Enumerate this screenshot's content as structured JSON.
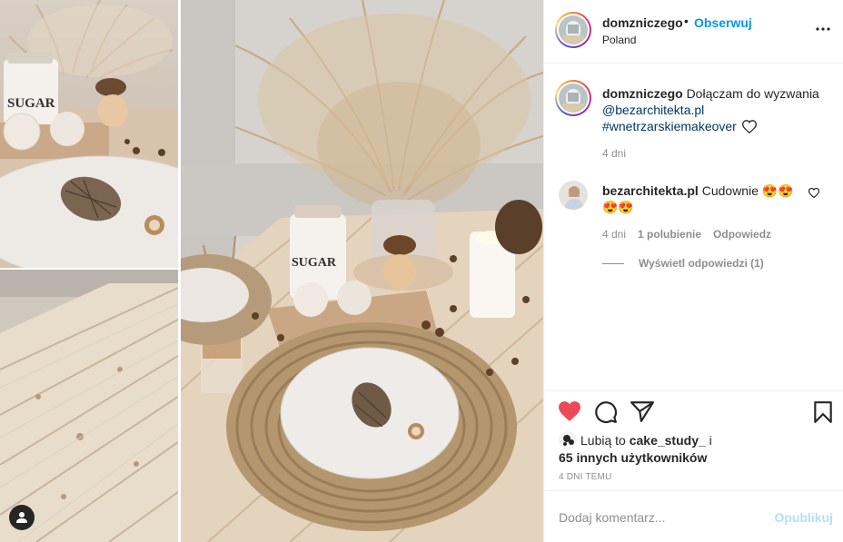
{
  "post": {
    "username": "domzniczego",
    "follow_label": "Obserwuj",
    "separator": "•",
    "location": "Poland",
    "more_icon": "more-horizontal-icon"
  },
  "caption": {
    "username": "domzniczego",
    "text": "Dołączam do wyzwania",
    "mention": "@bezarchitekta.pl",
    "hashtag": "#wnetrzarskiemakeover",
    "time": "4 dni"
  },
  "comment": {
    "username": "bezarchitekta.pl",
    "text": "Cudownie 😍😍😍😍",
    "time": "4 dni",
    "likes": "1 polubienie",
    "reply_label": "Odpowiedz",
    "view_replies": "Wyświetl odpowiedzi (1)"
  },
  "likes": {
    "prefix": "Lubią to",
    "user": "cake_study_",
    "conjunction": "i",
    "others": "65 innych użytkowników"
  },
  "date_label": "4 DNI TEMU",
  "add_comment": {
    "placeholder": "Dodaj komentarz...",
    "publish_label": "Opublikuj"
  },
  "media": {
    "jar_label": "SUGAR",
    "jar_label_small": "SUGAR"
  },
  "colors": {
    "like_red": "#ed4956",
    "link_blue": "#0095f6",
    "publish_disabled": "#b2dffc",
    "muted": "#8e8e8e"
  },
  "icons": [
    "heart-filled-icon",
    "comment-icon",
    "share-icon",
    "bookmark-icon",
    "user-tag-icon"
  ]
}
